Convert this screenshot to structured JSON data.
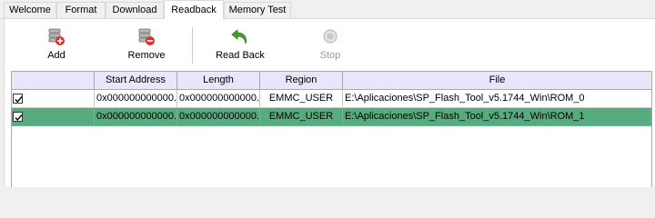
{
  "tabs": [
    {
      "label": "Welcome",
      "active": false
    },
    {
      "label": "Format",
      "active": false
    },
    {
      "label": "Download",
      "active": false
    },
    {
      "label": "Readback",
      "active": true
    },
    {
      "label": "Memory Test",
      "active": false
    }
  ],
  "toolbar": {
    "add_label": "Add",
    "remove_label": "Remove",
    "readback_label": "Read Back",
    "stop_label": "Stop",
    "add_icon": "add-db-icon",
    "remove_icon": "remove-db-icon",
    "readback_icon": "green-back-arrow-icon",
    "stop_icon": "stop-icon"
  },
  "table": {
    "columns": [
      "",
      "Start Address",
      "Length",
      "Region",
      "File"
    ],
    "rows": [
      {
        "checked": true,
        "start_address": "0x000000000000...",
        "length": "0x000000000000...",
        "region": "EMMC_USER",
        "file": "E:\\Aplicaciones\\SP_Flash_Tool_v5.1744_Win\\ROM_0",
        "selected": false
      },
      {
        "checked": true,
        "start_address": "0x000000000000...",
        "length": "0x000000000000...",
        "region": "EMMC_USER",
        "file": "E:\\Aplicaciones\\SP_Flash_Tool_v5.1744_Win\\ROM_1",
        "selected": true
      }
    ]
  },
  "colors": {
    "selected_row": "#57ac7f",
    "header_bg": "#e7e7fb",
    "readback_arrow": "#4a9d2a",
    "remove_badge": "#d8322c",
    "add_badge": "#d8322c"
  }
}
